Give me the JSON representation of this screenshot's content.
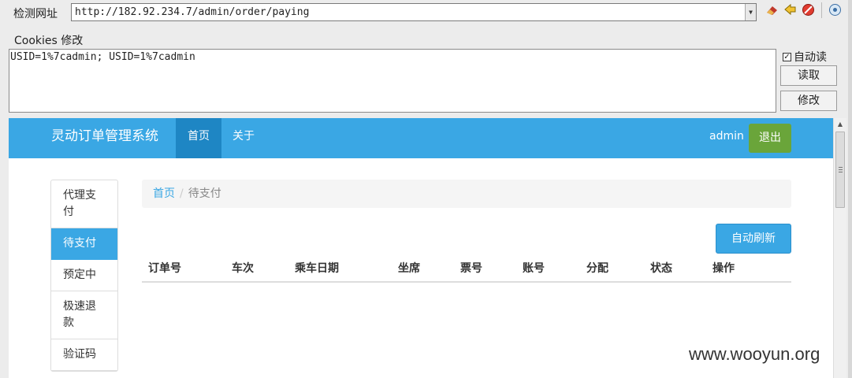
{
  "tool": {
    "url_label": "检测网址",
    "url_value": "http://182.92.234.7/admin/order/paying",
    "cookies_label": "Cookies 修改",
    "cookies_value": "USID=1%7cadmin; USID=1%7cadmin",
    "autoread_label": "自动读",
    "read_button": "读取",
    "modify_button": "修改",
    "icons": [
      "eraser-icon",
      "back-arrow-icon",
      "stop-icon",
      "settings-icon"
    ]
  },
  "site": {
    "brand": "灵动订单管理系统",
    "nav": {
      "home": "首页",
      "about": "关于"
    },
    "user": "admin",
    "logout": "退出",
    "colors": {
      "primary": "#3aa7e4",
      "nav_active": "#1e86c4",
      "logout": "#6aa53a"
    }
  },
  "sidebar": {
    "items": [
      {
        "label": "代理支付"
      },
      {
        "label": "待支付",
        "active": true
      },
      {
        "label": "预定中"
      },
      {
        "label": "极速退款"
      },
      {
        "label": "验证码"
      }
    ]
  },
  "breadcrumb": {
    "home": "首页",
    "separator": "/",
    "current": "待支付"
  },
  "refresh_button": "自动刷新",
  "table": {
    "columns": [
      "订单号",
      "车次",
      "乘车日期",
      "坐席",
      "票号",
      "账号",
      "分配",
      "状态",
      "操作"
    ]
  },
  "watermark": "www.wooyun.org"
}
